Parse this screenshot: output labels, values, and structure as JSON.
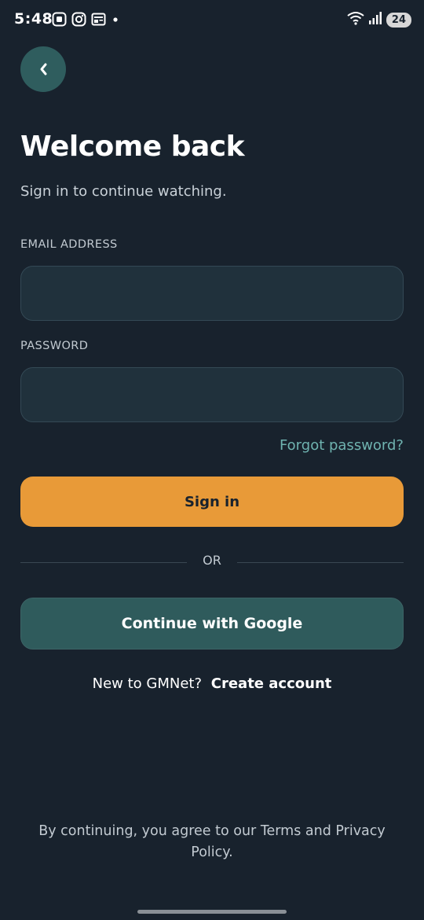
{
  "status_bar": {
    "time": "5:48",
    "battery": "24",
    "icons": [
      "screenshot-icon",
      "instagram-icon",
      "news-icon",
      "dot-icon",
      "wifi-icon",
      "signal-icon",
      "battery-icon"
    ]
  },
  "back_button": {
    "icon": "chevron-left-icon",
    "glyph": "‹"
  },
  "header": {
    "title": "Welcome back",
    "subtitle": "Sign in to continue watching."
  },
  "form": {
    "email_label": "EMAIL ADDRESS",
    "email_value": "",
    "password_label": "PASSWORD",
    "password_value": "",
    "forgot_password": "Forgot password?",
    "signin_label": "Sign in"
  },
  "divider": {
    "text": "OR"
  },
  "google_button": {
    "label": "Continue with Google"
  },
  "signup": {
    "prompt": "New to GMNet?",
    "link": "Create account"
  },
  "legal": {
    "text": "By continuing, you agree to our Terms and Privacy Policy."
  },
  "colors": {
    "background": "#18222d",
    "accent": "#e89a38",
    "teal": "#2f5b5c",
    "link": "#6fb3b0",
    "input_bg": "#20313c"
  }
}
